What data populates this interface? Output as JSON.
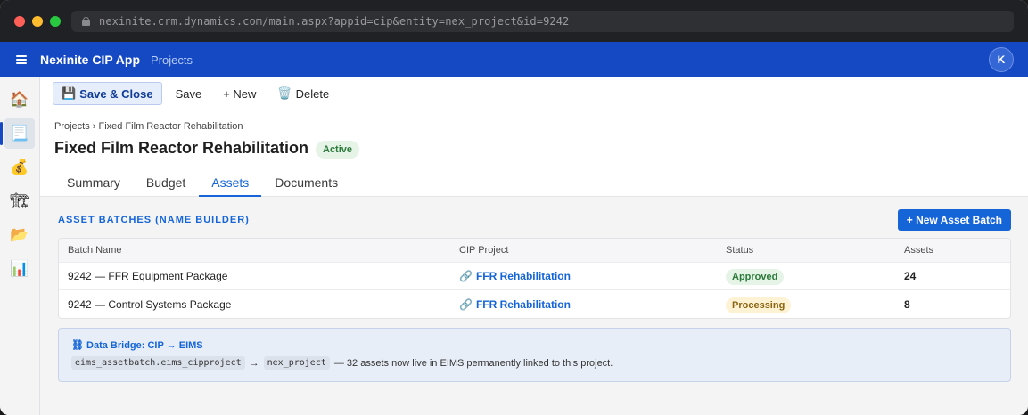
{
  "browser": {
    "url": "nexinite.crm.dynamics.com/main.aspx?appid=cip&entity=nex_project&id=9242"
  },
  "app": {
    "title": "Nexinite CIP App",
    "section": "Projects",
    "avatar_initial": "K"
  },
  "nav": {
    "items": [
      {
        "icon": "home-icon",
        "glyph": "🏠"
      },
      {
        "icon": "projects-icon",
        "glyph": "📃"
      },
      {
        "icon": "money-bag-icon",
        "glyph": "💰"
      },
      {
        "icon": "crane-icon",
        "glyph": "🏗"
      },
      {
        "icon": "folder-icon",
        "glyph": "📂"
      },
      {
        "icon": "bar-chart-icon",
        "glyph": "📊"
      }
    ]
  },
  "commands": {
    "save_close": "Save & Close",
    "save": "Save",
    "new": "+ New",
    "delete": "Delete"
  },
  "record": {
    "breadcrumb": "Projects › Fixed Film Reactor Rehabilitation",
    "title": "Fixed Film Reactor Rehabilitation",
    "status": "Active"
  },
  "tabs": [
    {
      "label": "Summary"
    },
    {
      "label": "Budget"
    },
    {
      "label": "Assets"
    },
    {
      "label": "Documents"
    }
  ],
  "assets": {
    "section_title": "ASSET BATCHES (NAME BUILDER)",
    "new_button": "+ New Asset Batch",
    "columns": {
      "name": "Batch Name",
      "project": "CIP Project",
      "status": "Status",
      "assets": "Assets"
    },
    "rows": [
      {
        "name": "9242 — FFR Equipment Package",
        "project": "FFR Rehabilitation",
        "status": "Approved",
        "assets": "24"
      },
      {
        "name": "9242 — Control Systems Package",
        "project": "FFR Rehabilitation",
        "status": "Processing",
        "assets": "8"
      }
    ]
  },
  "bridge": {
    "title": "⛓ Data Bridge: CIP → EIMS",
    "source_field": "eims_assetbatch.eims_cipproject",
    "arrow": "→",
    "target_field": "nex_project",
    "message": "— 32 assets now live in EIMS permanently linked to this project."
  },
  "colors": {
    "brand": "#1549c4",
    "accent": "#1565d8",
    "approved": "#2b7a3a",
    "processing": "#8c6410"
  }
}
